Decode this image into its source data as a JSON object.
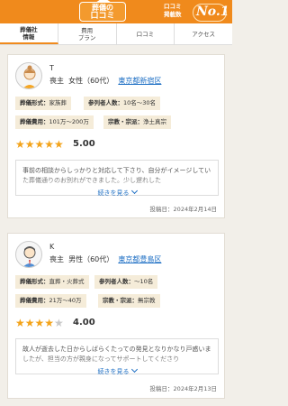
{
  "header": {
    "logo_line1": "葬儀の",
    "logo_line2": "口コミ",
    "badge_line1": "口コミ",
    "badge_line2": "掲載数",
    "badge_rank": "No.1"
  },
  "tabs": [
    {
      "label": "葬儀社\n情報",
      "active": true
    },
    {
      "label": "費用\nプラン",
      "active": false
    },
    {
      "label": "口コミ",
      "active": false
    },
    {
      "label": "アクセス",
      "active": false
    }
  ],
  "reviews": [
    {
      "name": "T",
      "role": "喪主",
      "gender_age": "女性（60代）",
      "location": "東京都新宿区",
      "funeral_type_label": "葬儀形式：",
      "funeral_type": "家族葬",
      "attendees_label": "参列者人数：",
      "attendees": "10名〜30名",
      "cost_label": "葬儀費用：",
      "cost": "101万〜200万",
      "religion_label": "宗教・宗派：",
      "religion": "浄土真宗",
      "rating": 5.0,
      "rating_text": "5.00",
      "stars_on": "★★★★★",
      "stars_off": "",
      "text": "事前の相談からしっかりと対応して下さり、自分がイメージしていた葬儀通りのお別れができました。少し遅れした",
      "more_label": "続きを見る",
      "date": "投稿日：2024年2月14日"
    },
    {
      "name": "K",
      "role": "喪主",
      "gender_age": "男性（60代）",
      "location": "東京都豊島区",
      "funeral_type_label": "葬儀形式：",
      "funeral_type": "直葬・火葬式",
      "attendees_label": "参列者人数：",
      "attendees": "〜10名",
      "cost_label": "葬儀費用：",
      "cost": "21万〜40万",
      "religion_label": "宗教・宗派：",
      "religion": "無宗教",
      "rating": 4.0,
      "rating_text": "4.00",
      "stars_on": "★★★★",
      "stars_off": "★",
      "text": "故人が逝去した日からしばらくたっての発見となりかなり戸惑いましたが、担当の方が親身になってサポートしてくださり",
      "more_label": "続きを見る",
      "date": "投稿日：2024年2月13日"
    }
  ]
}
